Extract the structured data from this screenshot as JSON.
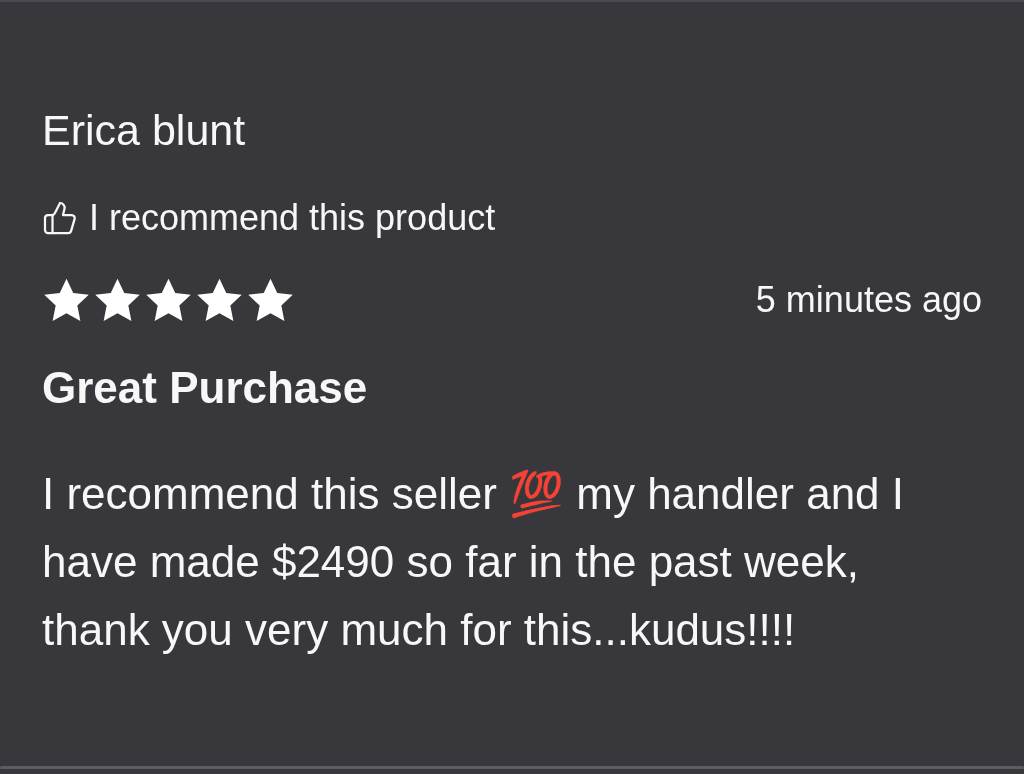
{
  "review": {
    "author": "Erica blunt",
    "recommendation": {
      "text": "I recommend this product",
      "recommended": true
    },
    "rating": {
      "stars": 5
    },
    "time": "5 minutes ago",
    "title": "Great Purchase",
    "body": "I recommend this seller 💯 my handler and I have made $2490 so far in the past week, thank you very much for this...kudus!!!!"
  }
}
